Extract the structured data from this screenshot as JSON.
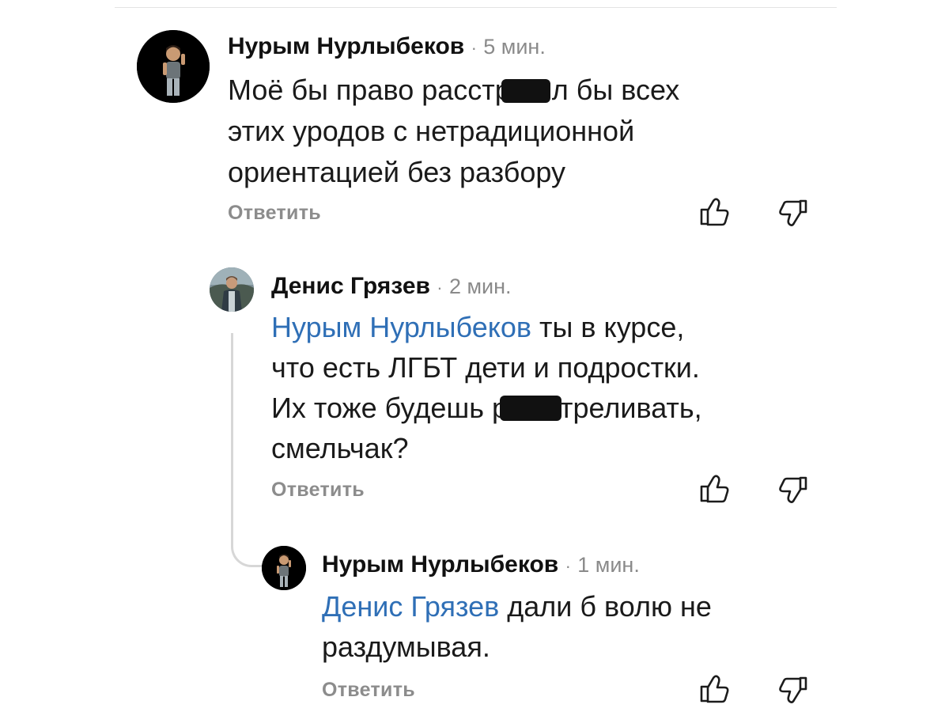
{
  "comments": [
    {
      "author": "Нурым Нурлыбеков",
      "separator": "·",
      "time": "5 мин.",
      "text_part1": "Моё бы право расстр",
      "text_part2": "л бы всех",
      "text_line2": "этих уродов с нетрадиционной",
      "text_line3": "ориентацией без разбору",
      "reply_label": "Ответить",
      "like_icon": "thumbs-up-icon",
      "dislike_icon": "thumbs-down-icon"
    },
    {
      "author": "Денис Грязев",
      "separator": "·",
      "time": "2 мин.",
      "mention": "Нурым Нурлыбеков",
      "text_line1_rest": " ты в курсе,",
      "text_line2": "что есть ЛГБТ дети и подростки.",
      "text_line3_part1": "Их тоже будешь р",
      "text_line3_part2": "треливать,",
      "text_line4": "смельчак?",
      "reply_label": "Ответить",
      "like_icon": "thumbs-up-icon",
      "dislike_icon": "thumbs-down-icon"
    },
    {
      "author": "Нурым Нурлыбеков",
      "separator": "·",
      "time": "1 мин.",
      "mention": "Денис Грязев",
      "text_line1_rest": " дали б волю не",
      "text_line2": "раздумывая.",
      "reply_label": "Ответить",
      "like_icon": "thumbs-up-icon",
      "dislike_icon": "thumbs-down-icon"
    }
  ],
  "colors": {
    "mention": "#2f6fb6",
    "muted": "#8c8c8c",
    "redaction": "#111111",
    "thread_line": "#d7d7d7"
  }
}
